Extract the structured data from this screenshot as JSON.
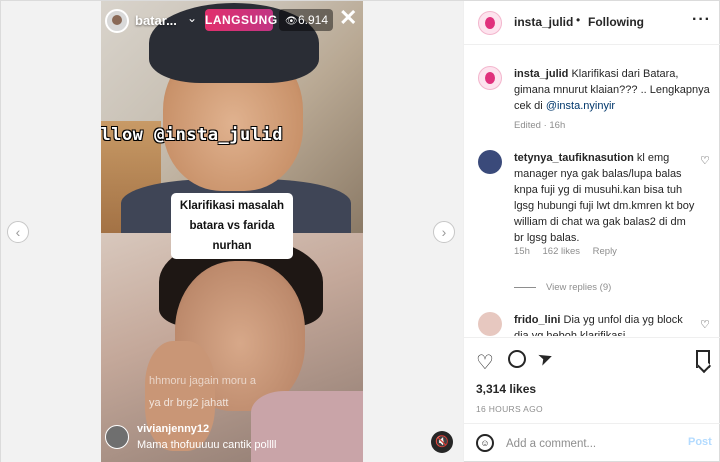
{
  "video": {
    "live_username": "batar...",
    "live_badge": "LANGSUNG",
    "viewer_count": "6.914",
    "close_glyph": "✕",
    "follow_overlay": "follow @insta_julid",
    "caption_overlay": "Klarifikasi masalah batara vs farida nurhan",
    "faint_chat_1": "hhmoru jagain moru a",
    "faint_chat_2": "ya dr brg2 jahatt",
    "chat_username": "vivianjenny12",
    "chat_text": "Mama thofuuuuu cantik pollll"
  },
  "header": {
    "username": "insta_julid",
    "dot": "•",
    "following_label": "Following",
    "more_glyph": "···"
  },
  "caption": {
    "username": "insta_julid",
    "text": "Klarifikasi dari Batara, gimana mnurut klaian??? .. Lengkapnya cek di",
    "mention": "@insta.nyinyir",
    "meta": "Edited · 16h"
  },
  "comments": [
    {
      "username": "tetynya_taufiknasution",
      "text": "kl emg manager nya gak balas/lupa balas knpa fuji yg di musuhi.kan bisa tuh lgsg hubungi fuji lwt dm.kmren kt boy william di chat wa gak balas2 di dm br lgsg balas.",
      "time": "15h",
      "likes": "162 likes",
      "reply": "Reply",
      "view_replies": "View replies (9)"
    },
    {
      "username": "frido_lini",
      "text": "Dia yg unfol dia yg block dia yg heboh klarifikasi"
    }
  ],
  "actions": {
    "likes": "3,314 likes",
    "time_ago": "16 HOURS AGO"
  },
  "add_comment": {
    "placeholder": "Add a comment...",
    "post_label": "Post"
  },
  "colors": {
    "live_badge": "#e1306c",
    "mention": "#00376b",
    "post_disabled": "#b3dbff"
  },
  "icons": [
    "chevron-left-icon",
    "chevron-right-icon",
    "eye-icon",
    "close-icon",
    "mute-icon",
    "heart-icon",
    "comment-icon",
    "share-icon",
    "bookmark-icon",
    "emoji-icon",
    "more-icon"
  ]
}
